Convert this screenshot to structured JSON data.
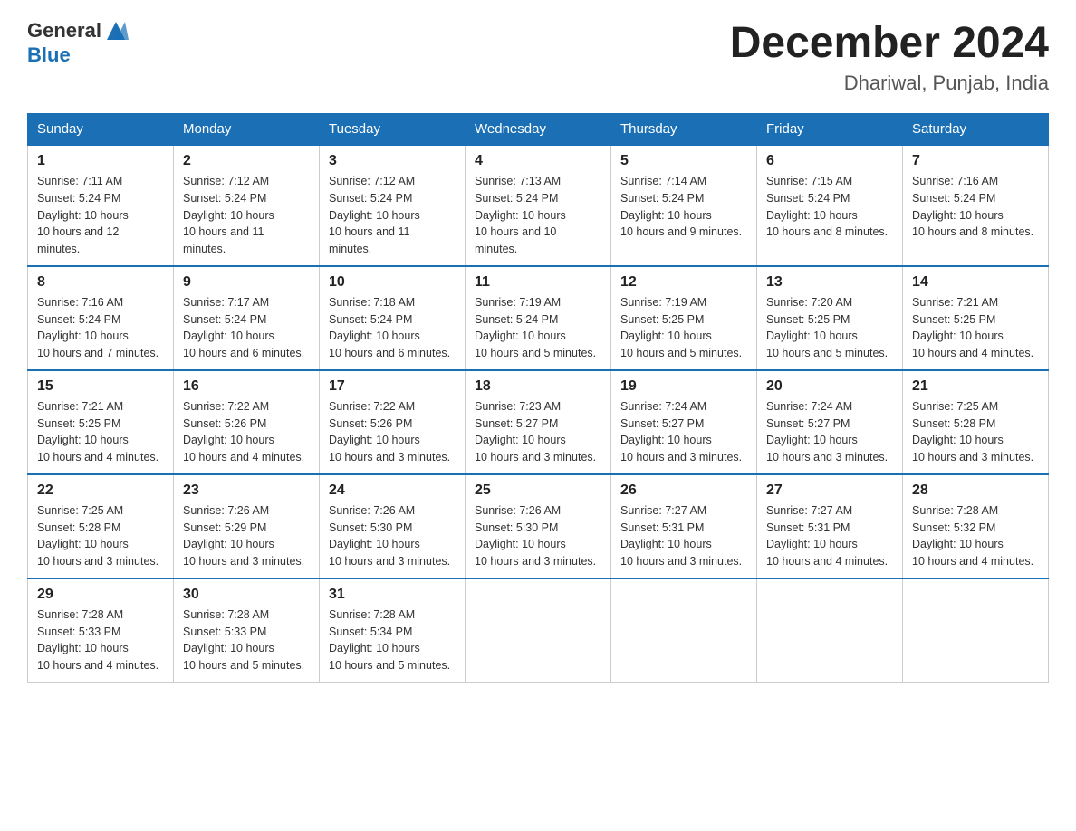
{
  "header": {
    "logo_general": "General",
    "logo_blue": "Blue",
    "month_title": "December 2024",
    "location": "Dhariwal, Punjab, India"
  },
  "weekdays": [
    "Sunday",
    "Monday",
    "Tuesday",
    "Wednesday",
    "Thursday",
    "Friday",
    "Saturday"
  ],
  "weeks": [
    [
      {
        "day": "1",
        "sunrise": "7:11 AM",
        "sunset": "5:24 PM",
        "daylight": "10 hours and 12 minutes."
      },
      {
        "day": "2",
        "sunrise": "7:12 AM",
        "sunset": "5:24 PM",
        "daylight": "10 hours and 11 minutes."
      },
      {
        "day": "3",
        "sunrise": "7:12 AM",
        "sunset": "5:24 PM",
        "daylight": "10 hours and 11 minutes."
      },
      {
        "day": "4",
        "sunrise": "7:13 AM",
        "sunset": "5:24 PM",
        "daylight": "10 hours and 10 minutes."
      },
      {
        "day": "5",
        "sunrise": "7:14 AM",
        "sunset": "5:24 PM",
        "daylight": "10 hours and 9 minutes."
      },
      {
        "day": "6",
        "sunrise": "7:15 AM",
        "sunset": "5:24 PM",
        "daylight": "10 hours and 8 minutes."
      },
      {
        "day": "7",
        "sunrise": "7:16 AM",
        "sunset": "5:24 PM",
        "daylight": "10 hours and 8 minutes."
      }
    ],
    [
      {
        "day": "8",
        "sunrise": "7:16 AM",
        "sunset": "5:24 PM",
        "daylight": "10 hours and 7 minutes."
      },
      {
        "day": "9",
        "sunrise": "7:17 AM",
        "sunset": "5:24 PM",
        "daylight": "10 hours and 6 minutes."
      },
      {
        "day": "10",
        "sunrise": "7:18 AM",
        "sunset": "5:24 PM",
        "daylight": "10 hours and 6 minutes."
      },
      {
        "day": "11",
        "sunrise": "7:19 AM",
        "sunset": "5:24 PM",
        "daylight": "10 hours and 5 minutes."
      },
      {
        "day": "12",
        "sunrise": "7:19 AM",
        "sunset": "5:25 PM",
        "daylight": "10 hours and 5 minutes."
      },
      {
        "day": "13",
        "sunrise": "7:20 AM",
        "sunset": "5:25 PM",
        "daylight": "10 hours and 5 minutes."
      },
      {
        "day": "14",
        "sunrise": "7:21 AM",
        "sunset": "5:25 PM",
        "daylight": "10 hours and 4 minutes."
      }
    ],
    [
      {
        "day": "15",
        "sunrise": "7:21 AM",
        "sunset": "5:25 PM",
        "daylight": "10 hours and 4 minutes."
      },
      {
        "day": "16",
        "sunrise": "7:22 AM",
        "sunset": "5:26 PM",
        "daylight": "10 hours and 4 minutes."
      },
      {
        "day": "17",
        "sunrise": "7:22 AM",
        "sunset": "5:26 PM",
        "daylight": "10 hours and 3 minutes."
      },
      {
        "day": "18",
        "sunrise": "7:23 AM",
        "sunset": "5:27 PM",
        "daylight": "10 hours and 3 minutes."
      },
      {
        "day": "19",
        "sunrise": "7:24 AM",
        "sunset": "5:27 PM",
        "daylight": "10 hours and 3 minutes."
      },
      {
        "day": "20",
        "sunrise": "7:24 AM",
        "sunset": "5:27 PM",
        "daylight": "10 hours and 3 minutes."
      },
      {
        "day": "21",
        "sunrise": "7:25 AM",
        "sunset": "5:28 PM",
        "daylight": "10 hours and 3 minutes."
      }
    ],
    [
      {
        "day": "22",
        "sunrise": "7:25 AM",
        "sunset": "5:28 PM",
        "daylight": "10 hours and 3 minutes."
      },
      {
        "day": "23",
        "sunrise": "7:26 AM",
        "sunset": "5:29 PM",
        "daylight": "10 hours and 3 minutes."
      },
      {
        "day": "24",
        "sunrise": "7:26 AM",
        "sunset": "5:30 PM",
        "daylight": "10 hours and 3 minutes."
      },
      {
        "day": "25",
        "sunrise": "7:26 AM",
        "sunset": "5:30 PM",
        "daylight": "10 hours and 3 minutes."
      },
      {
        "day": "26",
        "sunrise": "7:27 AM",
        "sunset": "5:31 PM",
        "daylight": "10 hours and 3 minutes."
      },
      {
        "day": "27",
        "sunrise": "7:27 AM",
        "sunset": "5:31 PM",
        "daylight": "10 hours and 4 minutes."
      },
      {
        "day": "28",
        "sunrise": "7:28 AM",
        "sunset": "5:32 PM",
        "daylight": "10 hours and 4 minutes."
      }
    ],
    [
      {
        "day": "29",
        "sunrise": "7:28 AM",
        "sunset": "5:33 PM",
        "daylight": "10 hours and 4 minutes."
      },
      {
        "day": "30",
        "sunrise": "7:28 AM",
        "sunset": "5:33 PM",
        "daylight": "10 hours and 5 minutes."
      },
      {
        "day": "31",
        "sunrise": "7:28 AM",
        "sunset": "5:34 PM",
        "daylight": "10 hours and 5 minutes."
      },
      null,
      null,
      null,
      null
    ]
  ]
}
